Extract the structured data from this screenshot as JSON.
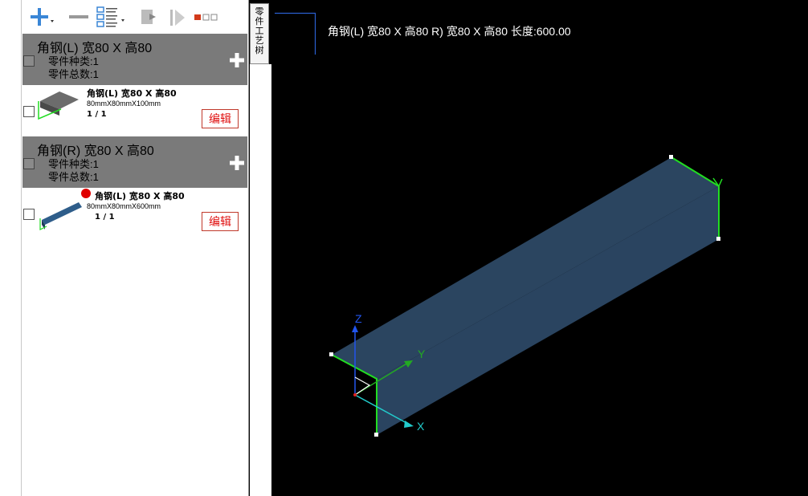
{
  "toolbar": {
    "icons": [
      "add-icon",
      "remove-icon",
      "list-view-icon",
      "export-icon",
      "run-icon",
      "layout-icon"
    ]
  },
  "groups": [
    {
      "title": "角钢(L) 宽80 X 高80",
      "kinds": "零件种类:1",
      "total": "零件总数:1",
      "item": {
        "title": "角钢(L) 宽80 X 高80",
        "dims": "80mmX80mmX100mm",
        "count": "1 / 1",
        "edit_label": "编辑"
      }
    },
    {
      "title": "角钢(R) 宽80 X 高80",
      "kinds": "零件种类:1",
      "total": "零件总数:1",
      "item": {
        "title": "角钢(L) 宽80 X 高80",
        "dims": "80mmX80mmX600mm",
        "count": "1 / 1",
        "edit_label": "编辑",
        "status_color": "#e00000"
      }
    }
  ],
  "side_tab": {
    "label": "零件工艺树"
  },
  "viewport": {
    "title": "角钢(L) 宽80 X 高80 R) 宽80 X 高80 长度:600.00",
    "axes": {
      "x": "X",
      "y": "Y",
      "z": "Z"
    },
    "colors": {
      "beam": "#2b4560",
      "edge": "#22dd22",
      "x_axis": "#22cccc",
      "y_axis": "#22aa22",
      "z_axis": "#2255ee"
    }
  }
}
